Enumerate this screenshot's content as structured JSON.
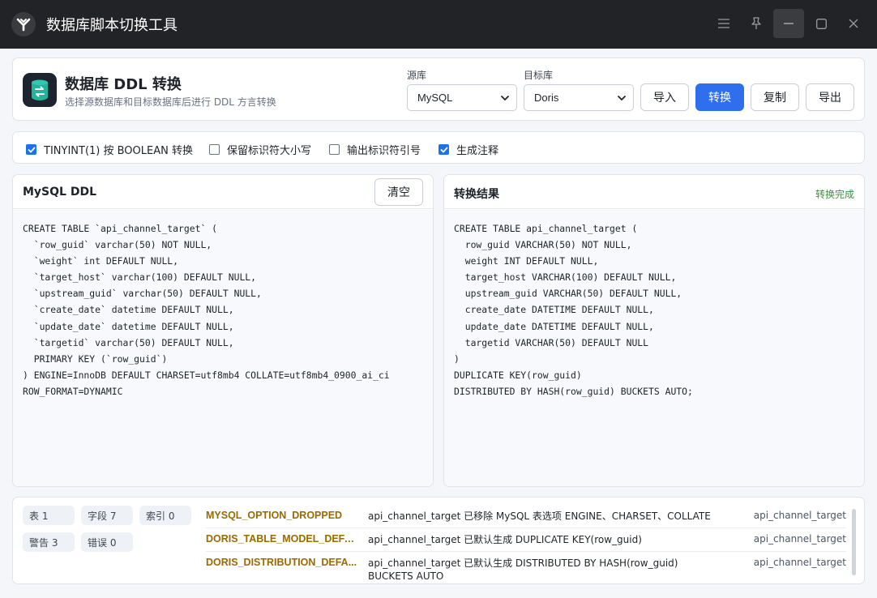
{
  "window": {
    "title": "数据库脚本切换工具",
    "controls": [
      "menu-icon",
      "pin-icon",
      "minimize-icon",
      "maximize-icon",
      "close-icon"
    ]
  },
  "header": {
    "title": "数据库 DDL 转换",
    "subtitle": "选择源数据库和目标数据库后进行 DDL 方言转换",
    "source_label": "源库",
    "source_value": "MySQL",
    "target_label": "目标库",
    "target_value": "Doris",
    "buttons": {
      "import": "导入",
      "convert": "转换",
      "copy": "复制",
      "export": "导出"
    }
  },
  "options": [
    {
      "label": "TINYINT(1) 按 BOOLEAN 转换",
      "checked": true
    },
    {
      "label": "保留标识符大小写",
      "checked": false
    },
    {
      "label": "输出标识符引号",
      "checked": false
    },
    {
      "label": "生成注释",
      "checked": true
    }
  ],
  "source_panel": {
    "title": "MySQL DDL",
    "clear_label": "清空",
    "code": "CREATE TABLE `api_channel_target` (\n  `row_guid` varchar(50) NOT NULL,\n  `weight` int DEFAULT NULL,\n  `target_host` varchar(100) DEFAULT NULL,\n  `upstream_guid` varchar(50) DEFAULT NULL,\n  `create_date` datetime DEFAULT NULL,\n  `update_date` datetime DEFAULT NULL,\n  `targetid` varchar(50) DEFAULT NULL,\n  PRIMARY KEY (`row_guid`)\n) ENGINE=InnoDB DEFAULT CHARSET=utf8mb4 COLLATE=utf8mb4_0900_ai_ci\nROW_FORMAT=DYNAMIC"
  },
  "result_panel": {
    "title": "转换结果",
    "status": "转换完成",
    "status_color": "#3d8f3d",
    "code": "CREATE TABLE api_channel_target (\n  row_guid VARCHAR(50) NOT NULL,\n  weight INT DEFAULT NULL,\n  target_host VARCHAR(100) DEFAULT NULL,\n  upstream_guid VARCHAR(50) DEFAULT NULL,\n  create_date DATETIME DEFAULT NULL,\n  update_date DATETIME DEFAULT NULL,\n  targetid VARCHAR(50) DEFAULT NULL\n)\nDUPLICATE KEY(row_guid)\nDISTRIBUTED BY HASH(row_guid) BUCKETS AUTO;"
  },
  "stats": {
    "tables": "表 1",
    "fields": "字段 7",
    "indexes": "索引 0",
    "warnings": "警告 3",
    "errors": "错误 0"
  },
  "issues": [
    {
      "code": "MYSQL_OPTION_DROPPED",
      "message": "api_channel_target 已移除 MySQL 表选项 ENGINE、CHARSET、COLLATE",
      "object": "api_channel_target"
    },
    {
      "code": "DORIS_TABLE_MODEL_DEFAU...",
      "message": "api_channel_target 已默认生成 DUPLICATE KEY(row_guid)",
      "object": "api_channel_target"
    },
    {
      "code": "DORIS_DISTRIBUTION_DEFA...",
      "message": "api_channel_target 已默认生成 DISTRIBUTED BY HASH(row_guid) BUCKETS AUTO",
      "object": "api_channel_target"
    }
  ],
  "colors": {
    "titlebar": "#222326",
    "primary": "#2f6fed",
    "issue_code": "#9a6a00"
  }
}
